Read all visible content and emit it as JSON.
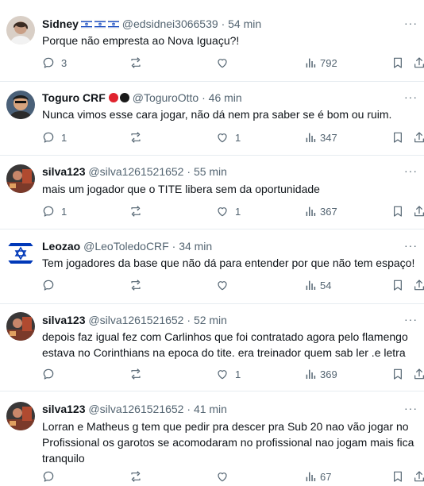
{
  "tweets": [
    {
      "name": "Sidney",
      "handle": "@edsidnei3066539",
      "sep": "·",
      "time": "54 min",
      "text": "Porque não empresta ao Nova Iguaçu?!",
      "replies": "3",
      "retweets": "",
      "likes": "",
      "views": "792",
      "badges": [
        "flag-israel",
        "flag-israel",
        "flag-israel"
      ]
    },
    {
      "name": "Toguro CRF",
      "handle": "@ToguroOtto",
      "sep": "·",
      "time": "46 min",
      "text": "Nunca vimos esse cara jogar, não dá nem pra saber se é bom ou ruim.",
      "replies": "1",
      "retweets": "",
      "likes": "1",
      "views": "347",
      "badges": [
        "red-circle",
        "black-circle"
      ]
    },
    {
      "name": "silva123",
      "handle": "@silva1261521652",
      "sep": "·",
      "time": "55 min",
      "text": "mais um jogador que o TITE libera sem da oportunidade",
      "replies": "1",
      "retweets": "",
      "likes": "1",
      "views": "367",
      "badges": []
    },
    {
      "name": "Leozao",
      "handle": "@LeoToledoCRF",
      "sep": "·",
      "time": "34 min",
      "text": "Tem jogadores da base que não dá para entender por que não tem espaço!",
      "replies": "",
      "retweets": "",
      "likes": "",
      "views": "54",
      "badges": []
    },
    {
      "name": "silva123",
      "handle": "@silva1261521652",
      "sep": "·",
      "time": "52 min",
      "text": "depois faz igual fez com Carlinhos que foi contratado agora pelo flamengo\nestava no Corinthians na epoca do tite. era treinador quem sab ler .e letra",
      "replies": "",
      "retweets": "",
      "likes": "1",
      "views": "369",
      "badges": []
    },
    {
      "name": "silva123",
      "handle": "@silva1261521652",
      "sep": "·",
      "time": "41 min",
      "text": "Lorran e Matheus g tem que pedir pra descer pra Sub 20 nao vão jogar no\nProfissional os garotos se acomodaram no profissional nao jogam mais fica\ntranquilo",
      "replies": "",
      "retweets": "",
      "likes": "",
      "views": "67",
      "badges": []
    }
  ],
  "icons": {
    "reply": "reply-icon",
    "retweet": "retweet-icon",
    "like": "heart-icon",
    "views": "views-icon",
    "bookmark": "bookmark-icon",
    "share": "share-icon",
    "more": "more-icon"
  },
  "colors": {
    "text": "#0f1419",
    "secondary": "#536471",
    "divider": "#e6ecf0",
    "israel_blue": "#0038b8"
  }
}
